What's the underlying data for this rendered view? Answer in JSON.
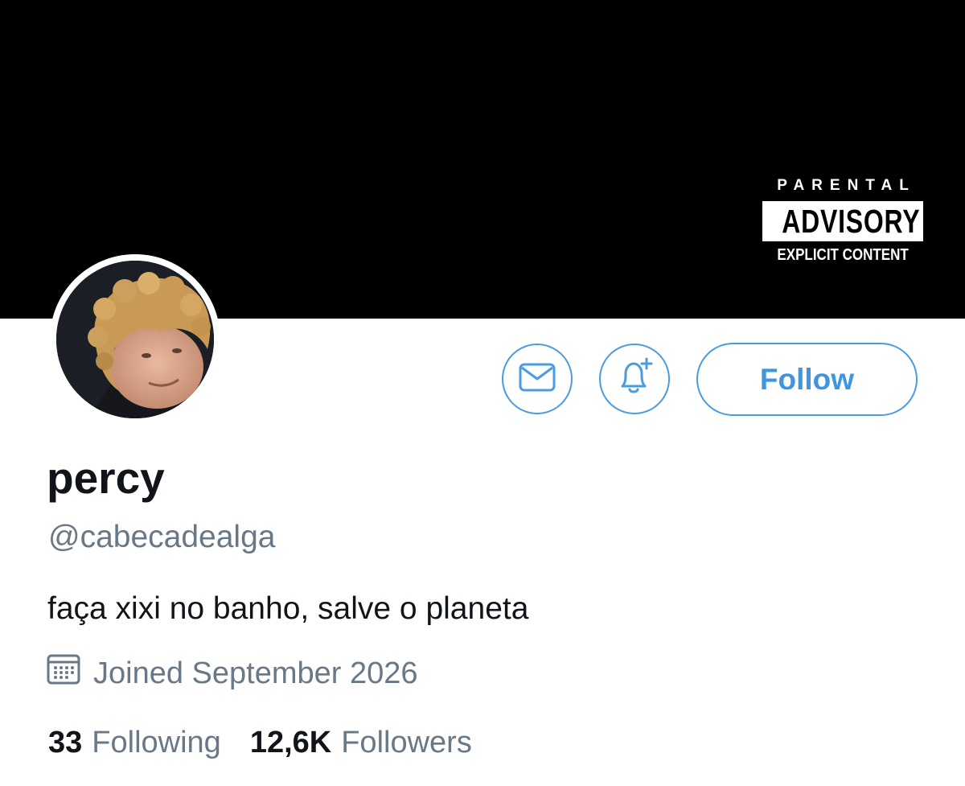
{
  "banner": {
    "advisory": {
      "line1": "PARENTAL",
      "line2": "ADVISORY",
      "line3": "EXPLICIT CONTENT"
    }
  },
  "profile": {
    "display_name": "percy",
    "handle": "@cabecadealga",
    "bio": "faça xixi no banho, salve o planeta",
    "joined": "Joined September 2026"
  },
  "actions": {
    "message_icon": "envelope-icon",
    "notify_icon": "bell-plus-icon",
    "follow_label": "Follow"
  },
  "stats": {
    "following_count": "33",
    "following_label": "Following",
    "followers_count": "12,6K",
    "followers_label": "Followers"
  },
  "colors": {
    "accent": "#3f95e0",
    "banner": "#000000",
    "secondary_text": "#687886",
    "primary_text": "#111418"
  }
}
